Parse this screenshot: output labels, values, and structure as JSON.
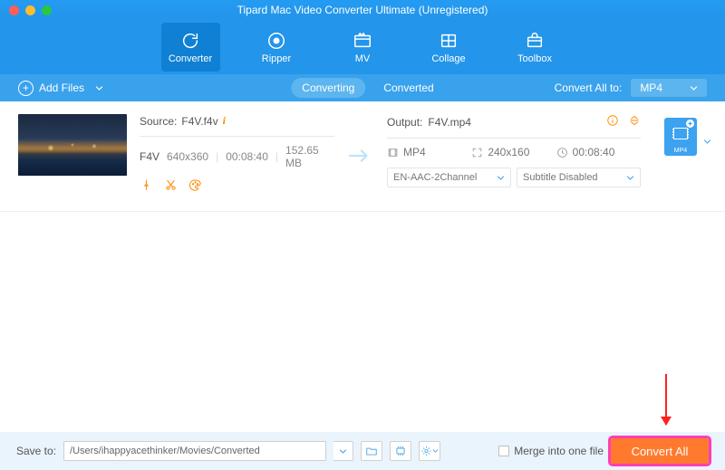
{
  "window": {
    "title": "Tipard Mac Video Converter Ultimate (Unregistered)"
  },
  "tabs": {
    "converter": "Converter",
    "ripper": "Ripper",
    "mv": "MV",
    "collage": "Collage",
    "toolbox": "Toolbox"
  },
  "subbar": {
    "add_files": "Add Files",
    "converting": "Converting",
    "converted": "Converted",
    "convert_all_to": "Convert All to:",
    "format": "MP4"
  },
  "file": {
    "source_label": "Source:",
    "source_name": "F4V.f4v",
    "fmt": "F4V",
    "resolution": "640x360",
    "duration": "00:08:40",
    "size": "152.65 MB",
    "output_label": "Output:",
    "output_name": "F4V.mp4",
    "out_fmt": "MP4",
    "out_res": "240x160",
    "out_dur": "00:08:40",
    "audio_sel": "EN-AAC-2Channel",
    "subtitle_sel": "Subtitle Disabled",
    "profile_label": "MP4"
  },
  "bottom": {
    "save_to": "Save to:",
    "path": "/Users/ihappyacethinker/Movies/Converted",
    "merge": "Merge into one file",
    "convert_all": "Convert All"
  }
}
